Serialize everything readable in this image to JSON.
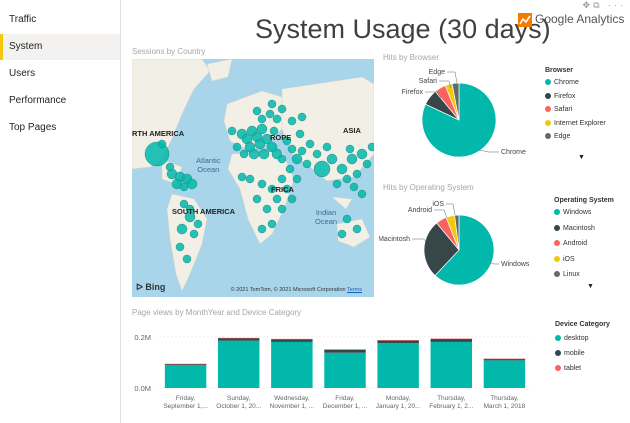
{
  "sidebar": {
    "items": [
      {
        "label": "Traffic",
        "active": false
      },
      {
        "label": "System",
        "active": true
      },
      {
        "label": "Users",
        "active": false
      },
      {
        "label": "Performance",
        "active": false
      },
      {
        "label": "Top Pages",
        "active": false
      }
    ]
  },
  "header": {
    "title": "System Usage (30 days)",
    "logo_text": "Google Analytics",
    "top_icons": "✥⧉ ···"
  },
  "map": {
    "section_label": "Sessions by Country",
    "labels": {
      "north_america": "RTH AMERICA",
      "europe": "ROPE",
      "asia": "ASIA",
      "africa": "FRICA",
      "south_america": "SOUTH AMERICA",
      "atlantic": "Atlantic\nOcean",
      "indian": "Indian\nOcean"
    },
    "bing": "Bing",
    "copyright": "© 2021 TomTom, © 2021 Microsoft Corporation",
    "terms": "Terms",
    "bubble_color": "#01b8aa"
  },
  "browser": {
    "section_label": "Hits by Browser",
    "legend_title": "Browser",
    "slices": [
      {
        "name": "Chrome",
        "value": 82,
        "color": "#01b8aa"
      },
      {
        "name": "Firefox",
        "value": 7,
        "color": "#374649"
      },
      {
        "name": "Safari",
        "value": 5,
        "color": "#fd625e"
      },
      {
        "name": "Internet Explorer",
        "value": 3,
        "color": "#f2c80f"
      },
      {
        "name": "Edge",
        "value": 3,
        "color": "#5f6b6d"
      }
    ],
    "callouts": [
      "Edge",
      "Safari",
      "Firefox",
      "Chrome"
    ]
  },
  "os": {
    "section_label": "Hits by Operating System",
    "legend_title": "Operating System",
    "slices": [
      {
        "name": "Windows",
        "value": 62,
        "color": "#01b8aa"
      },
      {
        "name": "Macintosh",
        "value": 27,
        "color": "#374649"
      },
      {
        "name": "Android",
        "value": 5,
        "color": "#fd625e"
      },
      {
        "name": "iOS",
        "value": 4,
        "color": "#f2c80f"
      },
      {
        "name": "Linux",
        "value": 2,
        "color": "#5f6b6d"
      }
    ],
    "callouts": [
      "iOS",
      "Android",
      "Macintosh",
      "Windows"
    ]
  },
  "pageviews": {
    "section_label": "Page views by MonthYear and Device Category",
    "legend_title": "Device Category",
    "legend": [
      {
        "name": "desktop",
        "color": "#01b8aa"
      },
      {
        "name": "mobile",
        "color": "#374649"
      },
      {
        "name": "tablet",
        "color": "#fd625e"
      }
    ]
  },
  "chart_data": {
    "type": "bar",
    "stacked": true,
    "categories": [
      [
        "Friday,",
        "September 1,..."
      ],
      [
        "Sunday,",
        "October 1, 20..."
      ],
      [
        "Wednesday,",
        "November 1, ..."
      ],
      [
        "Friday,",
        "December 1, ..."
      ],
      [
        "Monday,",
        "January 1, 20..."
      ],
      [
        "Thursday,",
        "February 1, 2..."
      ],
      [
        "Thursday,",
        "March 1, 2018"
      ]
    ],
    "series": [
      {
        "name": "desktop",
        "values": [
          0.09,
          0.185,
          0.18,
          0.138,
          0.175,
          0.18,
          0.108
        ]
      },
      {
        "name": "mobile",
        "values": [
          0.004,
          0.01,
          0.011,
          0.012,
          0.011,
          0.012,
          0.006
        ]
      },
      {
        "name": "tablet",
        "values": [
          0.0005,
          0.001,
          0.001,
          0.001,
          0.001,
          0.001,
          0.0005
        ]
      }
    ],
    "yticks": [
      "0.0M",
      "0.2M"
    ],
    "ylim": [
      0,
      0.25
    ],
    "grid": true
  }
}
